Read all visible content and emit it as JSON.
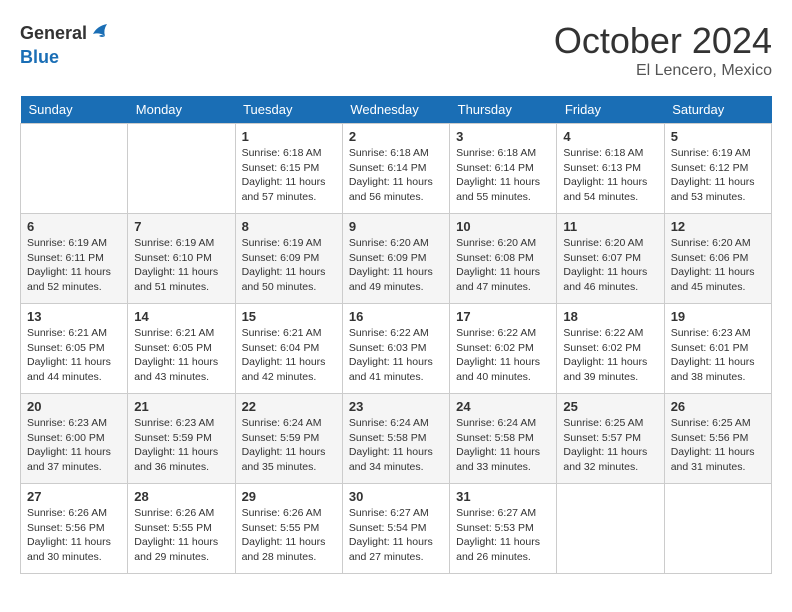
{
  "header": {
    "logo_general": "General",
    "logo_blue": "Blue",
    "month_title": "October 2024",
    "location": "El Lencero, Mexico"
  },
  "weekdays": [
    "Sunday",
    "Monday",
    "Tuesday",
    "Wednesday",
    "Thursday",
    "Friday",
    "Saturday"
  ],
  "weeks": [
    [
      {
        "day": "",
        "sunrise": "",
        "sunset": "",
        "daylight": ""
      },
      {
        "day": "",
        "sunrise": "",
        "sunset": "",
        "daylight": ""
      },
      {
        "day": "1",
        "sunrise": "Sunrise: 6:18 AM",
        "sunset": "Sunset: 6:15 PM",
        "daylight": "Daylight: 11 hours and 57 minutes."
      },
      {
        "day": "2",
        "sunrise": "Sunrise: 6:18 AM",
        "sunset": "Sunset: 6:14 PM",
        "daylight": "Daylight: 11 hours and 56 minutes."
      },
      {
        "day": "3",
        "sunrise": "Sunrise: 6:18 AM",
        "sunset": "Sunset: 6:14 PM",
        "daylight": "Daylight: 11 hours and 55 minutes."
      },
      {
        "day": "4",
        "sunrise": "Sunrise: 6:18 AM",
        "sunset": "Sunset: 6:13 PM",
        "daylight": "Daylight: 11 hours and 54 minutes."
      },
      {
        "day": "5",
        "sunrise": "Sunrise: 6:19 AM",
        "sunset": "Sunset: 6:12 PM",
        "daylight": "Daylight: 11 hours and 53 minutes."
      }
    ],
    [
      {
        "day": "6",
        "sunrise": "Sunrise: 6:19 AM",
        "sunset": "Sunset: 6:11 PM",
        "daylight": "Daylight: 11 hours and 52 minutes."
      },
      {
        "day": "7",
        "sunrise": "Sunrise: 6:19 AM",
        "sunset": "Sunset: 6:10 PM",
        "daylight": "Daylight: 11 hours and 51 minutes."
      },
      {
        "day": "8",
        "sunrise": "Sunrise: 6:19 AM",
        "sunset": "Sunset: 6:09 PM",
        "daylight": "Daylight: 11 hours and 50 minutes."
      },
      {
        "day": "9",
        "sunrise": "Sunrise: 6:20 AM",
        "sunset": "Sunset: 6:09 PM",
        "daylight": "Daylight: 11 hours and 49 minutes."
      },
      {
        "day": "10",
        "sunrise": "Sunrise: 6:20 AM",
        "sunset": "Sunset: 6:08 PM",
        "daylight": "Daylight: 11 hours and 47 minutes."
      },
      {
        "day": "11",
        "sunrise": "Sunrise: 6:20 AM",
        "sunset": "Sunset: 6:07 PM",
        "daylight": "Daylight: 11 hours and 46 minutes."
      },
      {
        "day": "12",
        "sunrise": "Sunrise: 6:20 AM",
        "sunset": "Sunset: 6:06 PM",
        "daylight": "Daylight: 11 hours and 45 minutes."
      }
    ],
    [
      {
        "day": "13",
        "sunrise": "Sunrise: 6:21 AM",
        "sunset": "Sunset: 6:05 PM",
        "daylight": "Daylight: 11 hours and 44 minutes."
      },
      {
        "day": "14",
        "sunrise": "Sunrise: 6:21 AM",
        "sunset": "Sunset: 6:05 PM",
        "daylight": "Daylight: 11 hours and 43 minutes."
      },
      {
        "day": "15",
        "sunrise": "Sunrise: 6:21 AM",
        "sunset": "Sunset: 6:04 PM",
        "daylight": "Daylight: 11 hours and 42 minutes."
      },
      {
        "day": "16",
        "sunrise": "Sunrise: 6:22 AM",
        "sunset": "Sunset: 6:03 PM",
        "daylight": "Daylight: 11 hours and 41 minutes."
      },
      {
        "day": "17",
        "sunrise": "Sunrise: 6:22 AM",
        "sunset": "Sunset: 6:02 PM",
        "daylight": "Daylight: 11 hours and 40 minutes."
      },
      {
        "day": "18",
        "sunrise": "Sunrise: 6:22 AM",
        "sunset": "Sunset: 6:02 PM",
        "daylight": "Daylight: 11 hours and 39 minutes."
      },
      {
        "day": "19",
        "sunrise": "Sunrise: 6:23 AM",
        "sunset": "Sunset: 6:01 PM",
        "daylight": "Daylight: 11 hours and 38 minutes."
      }
    ],
    [
      {
        "day": "20",
        "sunrise": "Sunrise: 6:23 AM",
        "sunset": "Sunset: 6:00 PM",
        "daylight": "Daylight: 11 hours and 37 minutes."
      },
      {
        "day": "21",
        "sunrise": "Sunrise: 6:23 AM",
        "sunset": "Sunset: 5:59 PM",
        "daylight": "Daylight: 11 hours and 36 minutes."
      },
      {
        "day": "22",
        "sunrise": "Sunrise: 6:24 AM",
        "sunset": "Sunset: 5:59 PM",
        "daylight": "Daylight: 11 hours and 35 minutes."
      },
      {
        "day": "23",
        "sunrise": "Sunrise: 6:24 AM",
        "sunset": "Sunset: 5:58 PM",
        "daylight": "Daylight: 11 hours and 34 minutes."
      },
      {
        "day": "24",
        "sunrise": "Sunrise: 6:24 AM",
        "sunset": "Sunset: 5:58 PM",
        "daylight": "Daylight: 11 hours and 33 minutes."
      },
      {
        "day": "25",
        "sunrise": "Sunrise: 6:25 AM",
        "sunset": "Sunset: 5:57 PM",
        "daylight": "Daylight: 11 hours and 32 minutes."
      },
      {
        "day": "26",
        "sunrise": "Sunrise: 6:25 AM",
        "sunset": "Sunset: 5:56 PM",
        "daylight": "Daylight: 11 hours and 31 minutes."
      }
    ],
    [
      {
        "day": "27",
        "sunrise": "Sunrise: 6:26 AM",
        "sunset": "Sunset: 5:56 PM",
        "daylight": "Daylight: 11 hours and 30 minutes."
      },
      {
        "day": "28",
        "sunrise": "Sunrise: 6:26 AM",
        "sunset": "Sunset: 5:55 PM",
        "daylight": "Daylight: 11 hours and 29 minutes."
      },
      {
        "day": "29",
        "sunrise": "Sunrise: 6:26 AM",
        "sunset": "Sunset: 5:55 PM",
        "daylight": "Daylight: 11 hours and 28 minutes."
      },
      {
        "day": "30",
        "sunrise": "Sunrise: 6:27 AM",
        "sunset": "Sunset: 5:54 PM",
        "daylight": "Daylight: 11 hours and 27 minutes."
      },
      {
        "day": "31",
        "sunrise": "Sunrise: 6:27 AM",
        "sunset": "Sunset: 5:53 PM",
        "daylight": "Daylight: 11 hours and 26 minutes."
      },
      {
        "day": "",
        "sunrise": "",
        "sunset": "",
        "daylight": ""
      },
      {
        "day": "",
        "sunrise": "",
        "sunset": "",
        "daylight": ""
      }
    ]
  ]
}
